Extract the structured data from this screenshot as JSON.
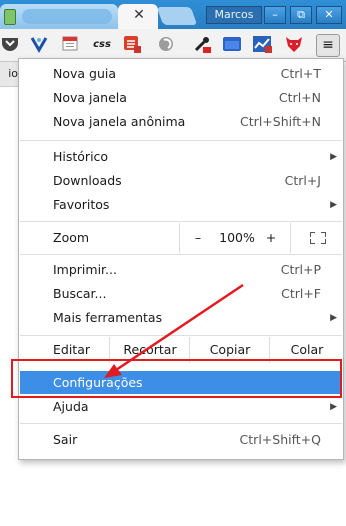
{
  "window": {
    "profile_name": "Marcos",
    "tab_close_glyph": "✕",
    "min_glyph": "–",
    "max_glyph": "⧉",
    "close_glyph": "✕"
  },
  "toolbar": {
    "extensions": [
      "pocket-icon",
      "vivaldi-icon",
      "calendar-icon",
      "css-icon",
      "todoist-icon",
      "ghostery-icon",
      "eyedropper-icon",
      "window-icon",
      "chart-icon",
      "foxy-icon"
    ],
    "css_label": "css",
    "menu_glyph": "≡"
  },
  "page_fragment": "io",
  "menu": {
    "new_tab": {
      "label": "Nova guia",
      "shortcut": "Ctrl+T"
    },
    "new_window": {
      "label": "Nova janela",
      "shortcut": "Ctrl+N"
    },
    "incognito": {
      "label": "Nova janela anônima",
      "shortcut": "Ctrl+Shift+N"
    },
    "history": {
      "label": "Histórico"
    },
    "downloads": {
      "label": "Downloads",
      "shortcut": "Ctrl+J"
    },
    "bookmarks": {
      "label": "Favoritos"
    },
    "zoom": {
      "label": "Zoom",
      "minus": "–",
      "value": "100%",
      "plus": "+"
    },
    "print": {
      "label": "Imprimir...",
      "shortcut": "Ctrl+P"
    },
    "find": {
      "label": "Buscar...",
      "shortcut": "Ctrl+F"
    },
    "more_tools": {
      "label": "Mais ferramentas"
    },
    "edit": {
      "label": "Editar",
      "cut": "Recortar",
      "copy": "Copiar",
      "paste": "Colar"
    },
    "settings": {
      "label": "Configurações"
    },
    "help": {
      "label": "Ajuda"
    },
    "exit": {
      "label": "Sair",
      "shortcut": "Ctrl+Shift+Q"
    },
    "submenu_arrow": "▶"
  },
  "colors": {
    "highlight": "#3d8ee6",
    "annotation_red": "#e11b22",
    "titlebar": "#2a7fc4"
  }
}
